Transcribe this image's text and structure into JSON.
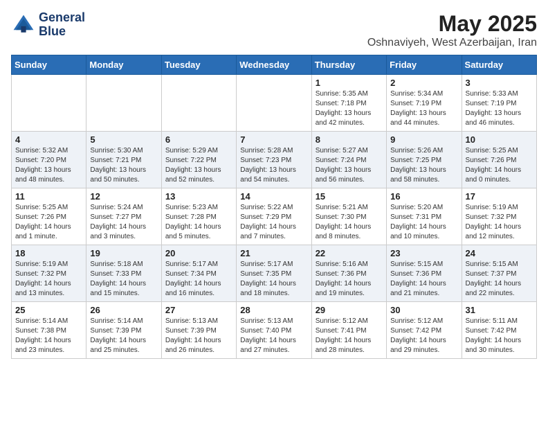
{
  "header": {
    "logo_line1": "General",
    "logo_line2": "Blue",
    "month_year": "May 2025",
    "location": "Oshnaviyeh, West Azerbaijan, Iran"
  },
  "days_of_week": [
    "Sunday",
    "Monday",
    "Tuesday",
    "Wednesday",
    "Thursday",
    "Friday",
    "Saturday"
  ],
  "weeks": [
    [
      {
        "day": "",
        "info": ""
      },
      {
        "day": "",
        "info": ""
      },
      {
        "day": "",
        "info": ""
      },
      {
        "day": "",
        "info": ""
      },
      {
        "day": "1",
        "info": "Sunrise: 5:35 AM\nSunset: 7:18 PM\nDaylight: 13 hours\nand 42 minutes."
      },
      {
        "day": "2",
        "info": "Sunrise: 5:34 AM\nSunset: 7:19 PM\nDaylight: 13 hours\nand 44 minutes."
      },
      {
        "day": "3",
        "info": "Sunrise: 5:33 AM\nSunset: 7:19 PM\nDaylight: 13 hours\nand 46 minutes."
      }
    ],
    [
      {
        "day": "4",
        "info": "Sunrise: 5:32 AM\nSunset: 7:20 PM\nDaylight: 13 hours\nand 48 minutes."
      },
      {
        "day": "5",
        "info": "Sunrise: 5:30 AM\nSunset: 7:21 PM\nDaylight: 13 hours\nand 50 minutes."
      },
      {
        "day": "6",
        "info": "Sunrise: 5:29 AM\nSunset: 7:22 PM\nDaylight: 13 hours\nand 52 minutes."
      },
      {
        "day": "7",
        "info": "Sunrise: 5:28 AM\nSunset: 7:23 PM\nDaylight: 13 hours\nand 54 minutes."
      },
      {
        "day": "8",
        "info": "Sunrise: 5:27 AM\nSunset: 7:24 PM\nDaylight: 13 hours\nand 56 minutes."
      },
      {
        "day": "9",
        "info": "Sunrise: 5:26 AM\nSunset: 7:25 PM\nDaylight: 13 hours\nand 58 minutes."
      },
      {
        "day": "10",
        "info": "Sunrise: 5:25 AM\nSunset: 7:26 PM\nDaylight: 14 hours\nand 0 minutes."
      }
    ],
    [
      {
        "day": "11",
        "info": "Sunrise: 5:25 AM\nSunset: 7:26 PM\nDaylight: 14 hours\nand 1 minute."
      },
      {
        "day": "12",
        "info": "Sunrise: 5:24 AM\nSunset: 7:27 PM\nDaylight: 14 hours\nand 3 minutes."
      },
      {
        "day": "13",
        "info": "Sunrise: 5:23 AM\nSunset: 7:28 PM\nDaylight: 14 hours\nand 5 minutes."
      },
      {
        "day": "14",
        "info": "Sunrise: 5:22 AM\nSunset: 7:29 PM\nDaylight: 14 hours\nand 7 minutes."
      },
      {
        "day": "15",
        "info": "Sunrise: 5:21 AM\nSunset: 7:30 PM\nDaylight: 14 hours\nand 8 minutes."
      },
      {
        "day": "16",
        "info": "Sunrise: 5:20 AM\nSunset: 7:31 PM\nDaylight: 14 hours\nand 10 minutes."
      },
      {
        "day": "17",
        "info": "Sunrise: 5:19 AM\nSunset: 7:32 PM\nDaylight: 14 hours\nand 12 minutes."
      }
    ],
    [
      {
        "day": "18",
        "info": "Sunrise: 5:19 AM\nSunset: 7:32 PM\nDaylight: 14 hours\nand 13 minutes."
      },
      {
        "day": "19",
        "info": "Sunrise: 5:18 AM\nSunset: 7:33 PM\nDaylight: 14 hours\nand 15 minutes."
      },
      {
        "day": "20",
        "info": "Sunrise: 5:17 AM\nSunset: 7:34 PM\nDaylight: 14 hours\nand 16 minutes."
      },
      {
        "day": "21",
        "info": "Sunrise: 5:17 AM\nSunset: 7:35 PM\nDaylight: 14 hours\nand 18 minutes."
      },
      {
        "day": "22",
        "info": "Sunrise: 5:16 AM\nSunset: 7:36 PM\nDaylight: 14 hours\nand 19 minutes."
      },
      {
        "day": "23",
        "info": "Sunrise: 5:15 AM\nSunset: 7:36 PM\nDaylight: 14 hours\nand 21 minutes."
      },
      {
        "day": "24",
        "info": "Sunrise: 5:15 AM\nSunset: 7:37 PM\nDaylight: 14 hours\nand 22 minutes."
      }
    ],
    [
      {
        "day": "25",
        "info": "Sunrise: 5:14 AM\nSunset: 7:38 PM\nDaylight: 14 hours\nand 23 minutes."
      },
      {
        "day": "26",
        "info": "Sunrise: 5:14 AM\nSunset: 7:39 PM\nDaylight: 14 hours\nand 25 minutes."
      },
      {
        "day": "27",
        "info": "Sunrise: 5:13 AM\nSunset: 7:39 PM\nDaylight: 14 hours\nand 26 minutes."
      },
      {
        "day": "28",
        "info": "Sunrise: 5:13 AM\nSunset: 7:40 PM\nDaylight: 14 hours\nand 27 minutes."
      },
      {
        "day": "29",
        "info": "Sunrise: 5:12 AM\nSunset: 7:41 PM\nDaylight: 14 hours\nand 28 minutes."
      },
      {
        "day": "30",
        "info": "Sunrise: 5:12 AM\nSunset: 7:42 PM\nDaylight: 14 hours\nand 29 minutes."
      },
      {
        "day": "31",
        "info": "Sunrise: 5:11 AM\nSunset: 7:42 PM\nDaylight: 14 hours\nand 30 minutes."
      }
    ]
  ]
}
